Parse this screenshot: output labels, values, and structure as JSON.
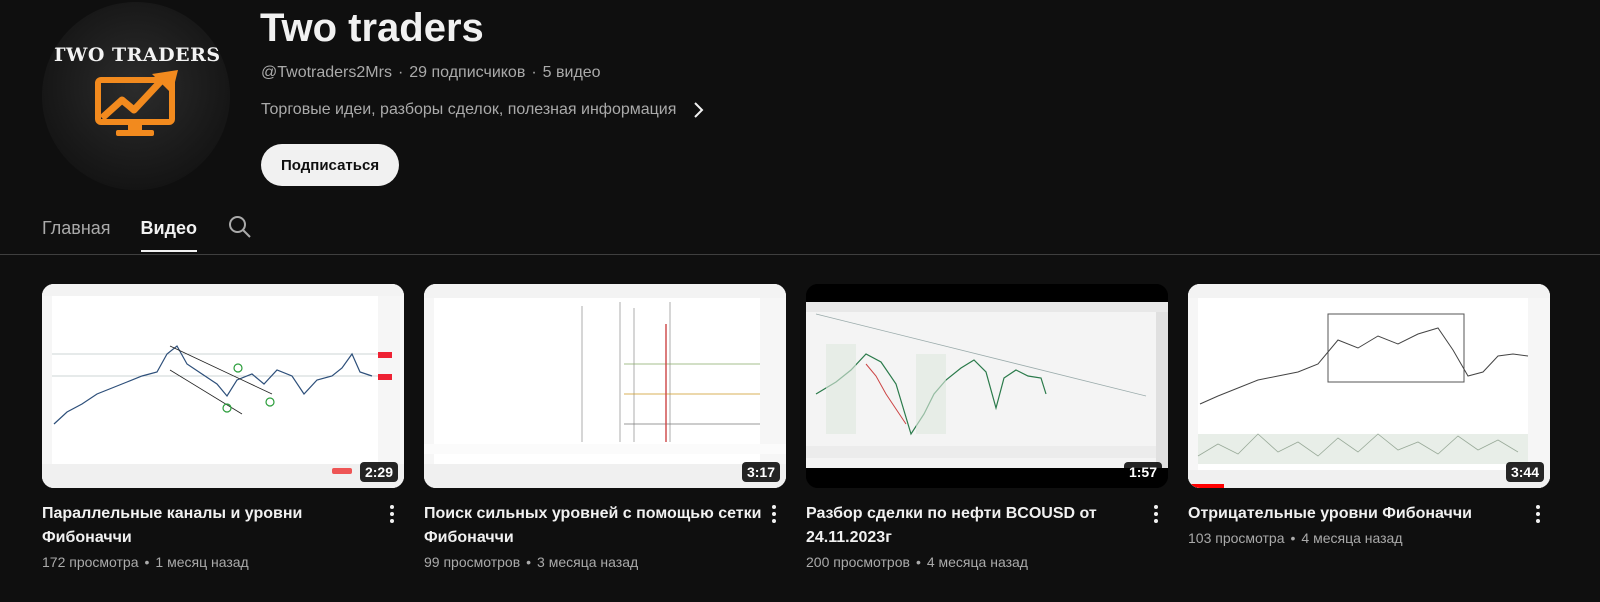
{
  "channel": {
    "avatar_text": "TWO TRADERS",
    "title": "Two traders",
    "handle": "@Twotraders2Mrs",
    "subscribers": "29 подписчиков",
    "video_count": "5 видео",
    "meta_separator": "·",
    "description": "Торговые идеи, разборы сделок, полезная информация",
    "subscribe_label": "Подписаться"
  },
  "tabs": [
    {
      "label": "Главная",
      "active": false
    },
    {
      "label": "Видео",
      "active": true
    }
  ],
  "videos": [
    {
      "title": "Параллельные каналы и уровни Фибоначчи",
      "views": "172 просмотра",
      "age": "1 месяц назад",
      "duration": "2:29"
    },
    {
      "title": "Поиск сильных уровней с помощью сетки Фибоначчи",
      "views": "99 просмотров",
      "age": "3 месяца назад",
      "duration": "3:17"
    },
    {
      "title": "Разбор сделки по нефти BCOUSD от 24.11.2023г",
      "views": "200 просмотров",
      "age": "4 месяца назад",
      "duration": "1:57"
    },
    {
      "title": "Отрицательные уровни Фибоначчи",
      "views": "103 просмотра",
      "age": "4 месяца назад",
      "duration": "3:44",
      "watched_progress": 0.1
    }
  ],
  "meta_dot": "•",
  "icons": {
    "search": "search-icon",
    "chevron": "chevron-right-icon",
    "more": "more-vert-icon",
    "logo": "chart-monitor-icon"
  },
  "colors": {
    "background": "#0f0f0f",
    "text": "#f1f1f1",
    "secondary_text": "#aaaaaa",
    "logo_orange": "#f28a1e",
    "progress_red": "#ff0000"
  }
}
